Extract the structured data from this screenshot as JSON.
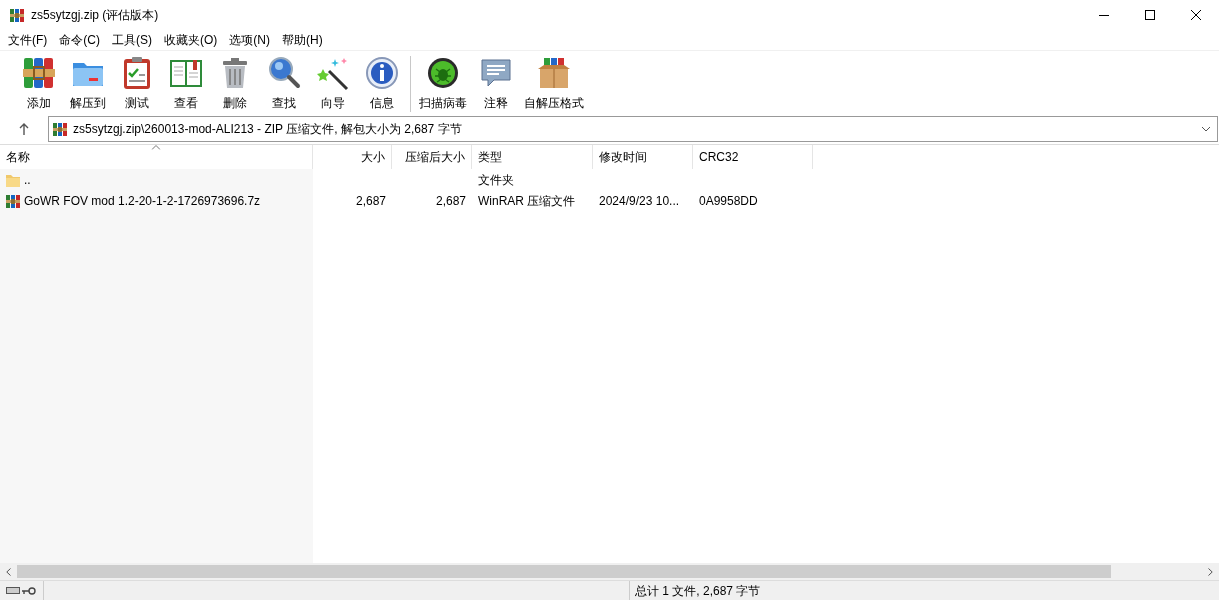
{
  "window": {
    "title": "zs5sytzgj.zip (评估版本)"
  },
  "menu": [
    "文件(F)",
    "命令(C)",
    "工具(S)",
    "收藏夹(O)",
    "选项(N)",
    "帮助(H)"
  ],
  "toolbar": [
    {
      "kind": "add",
      "label": "添加"
    },
    {
      "kind": "extract",
      "label": "解压到"
    },
    {
      "kind": "test",
      "label": "测试"
    },
    {
      "kind": "view",
      "label": "查看"
    },
    {
      "kind": "delete",
      "label": "删除"
    },
    {
      "kind": "find",
      "label": "查找"
    },
    {
      "kind": "wizard",
      "label": "向导"
    },
    {
      "kind": "info",
      "label": "信息"
    },
    {
      "kind": "separator"
    },
    {
      "kind": "scan",
      "label": "扫描病毒"
    },
    {
      "kind": "comment",
      "label": "注释"
    },
    {
      "kind": "sfx",
      "label": "自解压格式"
    }
  ],
  "address": {
    "path": "zs5sytzgj.zip\\260013-mod-ALI213 - ZIP 压缩文件, 解包大小为 2,687 字节"
  },
  "table": {
    "columns": [
      {
        "label": "名称",
        "sorted": true
      },
      {
        "label": "大小",
        "sorted": false
      },
      {
        "label": "压缩后大小",
        "sorted": false
      },
      {
        "label": "类型",
        "sorted": false
      },
      {
        "label": "修改时间",
        "sorted": false
      },
      {
        "label": "CRC32",
        "sorted": false
      }
    ],
    "rows": [
      {
        "kind": "folder",
        "cells": [
          "..",
          "",
          "",
          "文件夹",
          "",
          ""
        ]
      },
      {
        "kind": "archive",
        "cells": [
          "GoWR FOV mod 1.2-20-1-2-1726973696.7z",
          "2,687",
          "2,687",
          "WinRAR 压缩文件",
          "2024/9/23 10...",
          "0A9958DD"
        ]
      }
    ]
  },
  "status_bar": {
    "text": "总计 1 文件, 2,687 字节"
  }
}
